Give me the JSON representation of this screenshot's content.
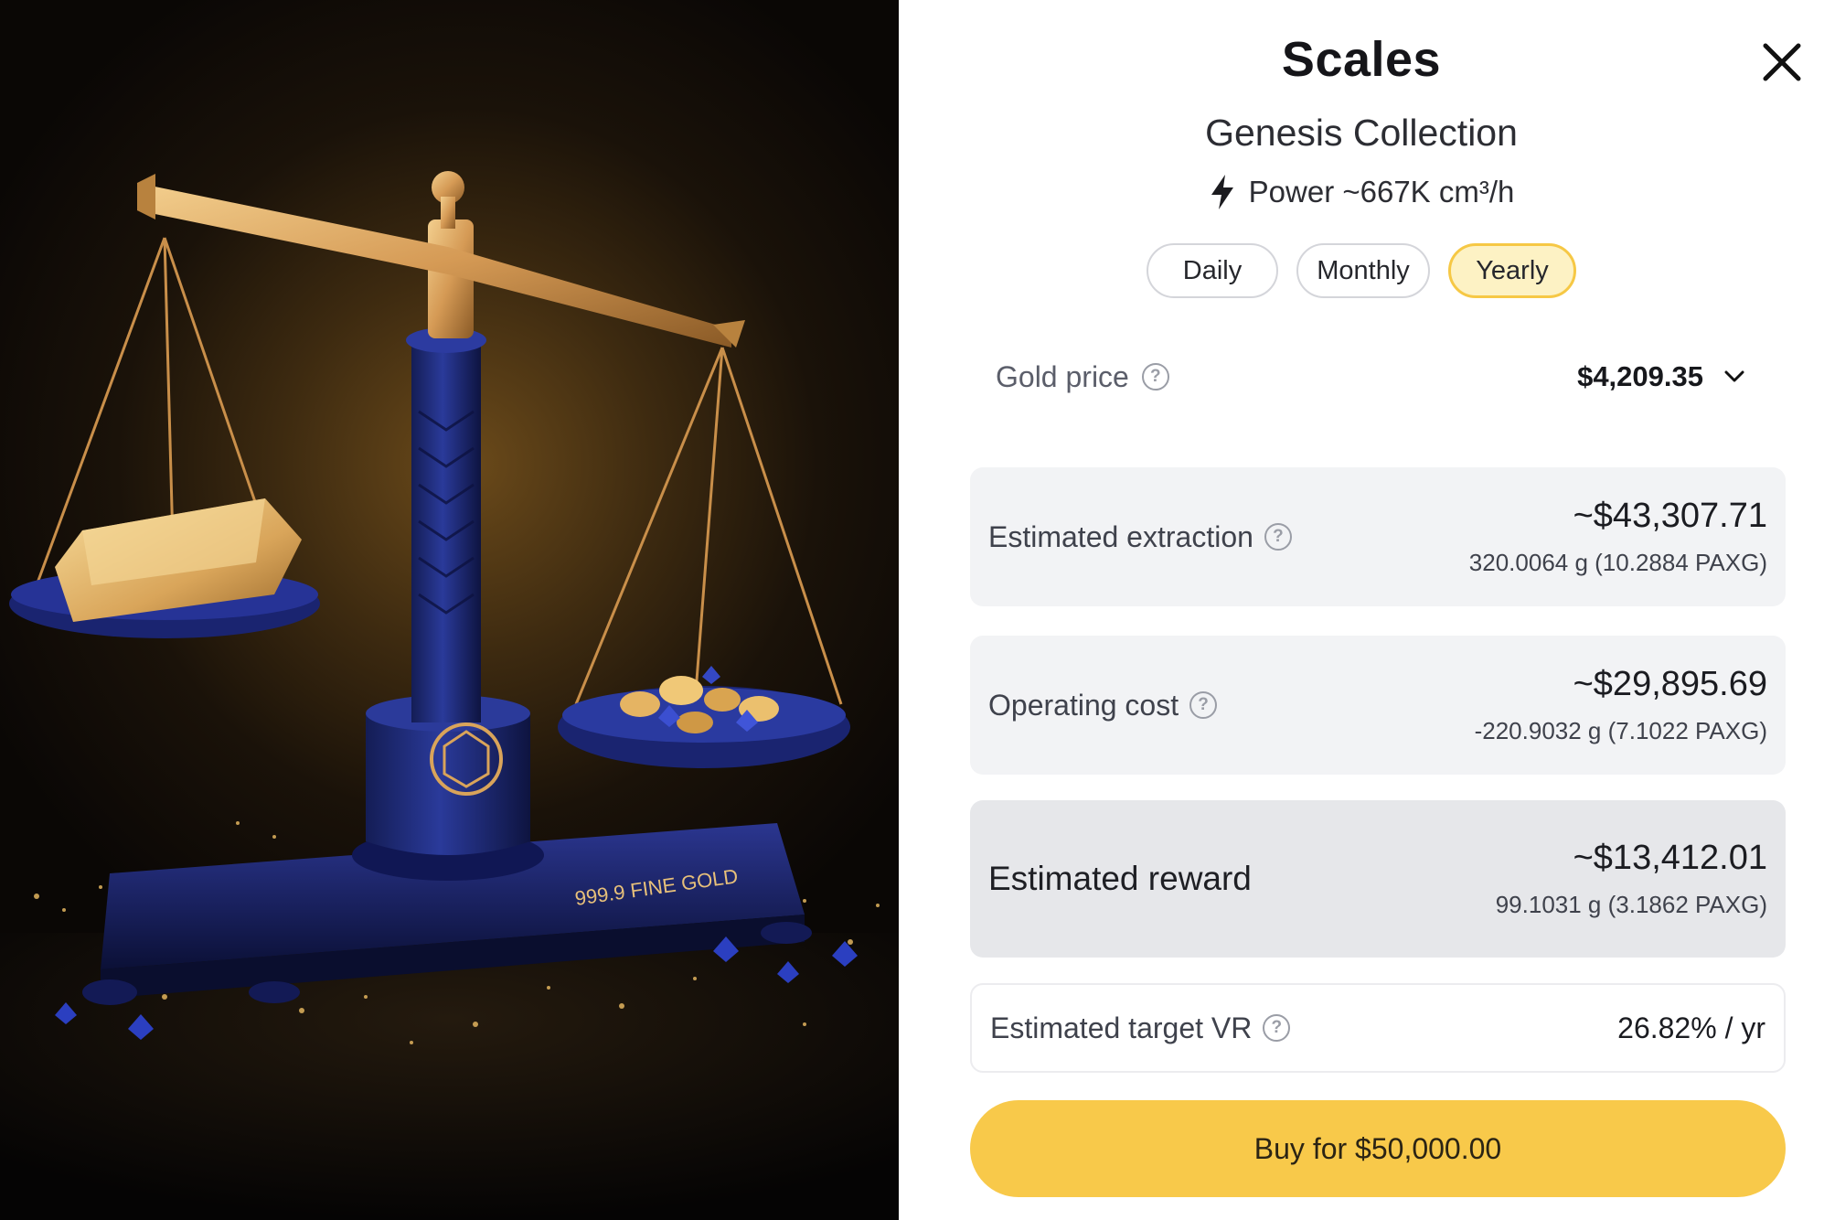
{
  "artwork": {
    "engraving": "999.9 FINE GOLD"
  },
  "header": {
    "title": "Scales",
    "subtitle": "Genesis Collection",
    "power": "Power ~667K cm³/h"
  },
  "periods": [
    {
      "label": "Daily",
      "selected": false
    },
    {
      "label": "Monthly",
      "selected": false
    },
    {
      "label": "Yearly",
      "selected": true
    }
  ],
  "gold_price": {
    "label": "Gold price",
    "value": "$4,209.35"
  },
  "cards": {
    "extraction": {
      "label": "Estimated extraction",
      "value": "~$43,307.71",
      "detail": "320.0064 g (10.2884 PAXG)"
    },
    "operating": {
      "label": "Operating cost",
      "value": "~$29,895.69",
      "detail": "-220.9032 g (7.1022 PAXG)"
    },
    "reward": {
      "label": "Estimated reward",
      "value": "~$13,412.01",
      "detail": "99.1031 g (3.1862 PAXG)"
    },
    "target_vr": {
      "label": "Estimated target VR",
      "value": "26.82% / yr"
    }
  },
  "buy_button": {
    "label": "Buy for $50,000.00"
  },
  "colors": {
    "accent": "#f8c94a",
    "selected_pill_bg": "#fdf2c4",
    "selected_pill_border": "#f6c845",
    "card_bg": "#f2f3f5",
    "reward_bg": "#e6e7ea",
    "navy": "#1e2a78",
    "gold": "#d9a45a"
  },
  "icons": [
    "close-icon",
    "lightning-icon",
    "help-icon",
    "chevron-down-icon"
  ]
}
